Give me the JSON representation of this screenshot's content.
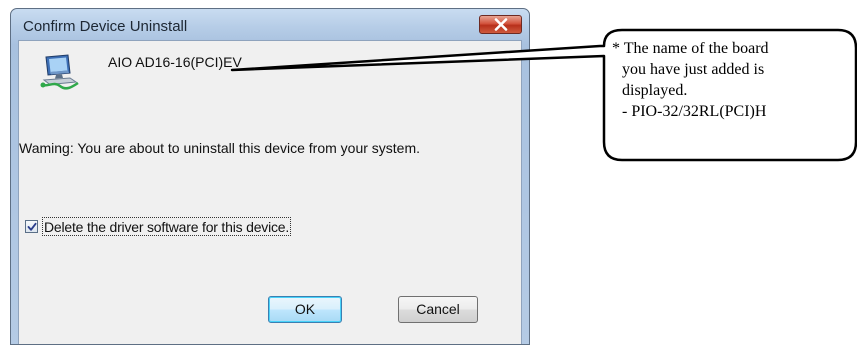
{
  "window": {
    "title": "Confirm Device Uninstall",
    "close_icon": "close-x-icon"
  },
  "device": {
    "icon": "network-device-icon",
    "name": "AIO AD16-16(PCI)EV"
  },
  "warning": "Waming: You are about to uninstall this device from your system.",
  "checkbox": {
    "label": "Delete the driver software for this device.",
    "checked": true
  },
  "buttons": {
    "ok": "OK",
    "cancel": "Cancel"
  },
  "callout": {
    "line1": "* The name of the board",
    "line2": "you have just added is",
    "line3": "displayed.",
    "line4": "- PIO-32/32RL(PCI)H"
  }
}
